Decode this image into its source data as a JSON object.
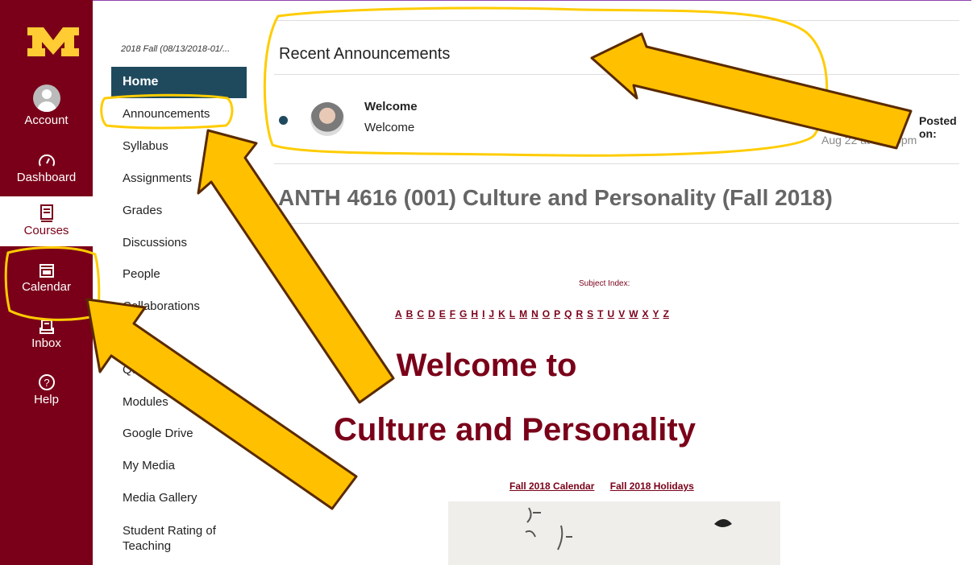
{
  "global_nav": {
    "logo_icon": "university-m-logo-icon",
    "items": [
      {
        "label": "Account",
        "icon": "account-icon"
      },
      {
        "label": "Dashboard",
        "icon": "dashboard-icon"
      },
      {
        "label": "Courses",
        "icon": "courses-icon"
      },
      {
        "label": "Calendar",
        "icon": "calendar-icon"
      },
      {
        "label": "Inbox",
        "icon": "inbox-icon"
      },
      {
        "label": "Help",
        "icon": "help-icon"
      }
    ]
  },
  "course_nav": {
    "term": "2018 Fall (08/13/2018-01/...",
    "items": [
      "Home",
      "Announcements",
      "Syllabus",
      "Assignments",
      "Grades",
      "Discussions",
      "People",
      "Collaborations",
      "",
      "Quizzes",
      "Modules",
      "Google Drive",
      "My Media",
      "Media Gallery",
      "Student Rating of Teaching"
    ]
  },
  "announcements": {
    "title": "Recent Announcements",
    "item": {
      "heading": "Welcome",
      "body": "Welcome",
      "posted_label": "Posted on:",
      "posted_date": "Aug 22 at 10:05pm"
    }
  },
  "course_title": "ANTH 4616 (001) Culture and Personality (Fall 2018)",
  "subject_index": {
    "label": "Subject Index:",
    "letters": [
      "A",
      "B",
      "C",
      "D",
      "E",
      "F",
      "G",
      "H",
      "I",
      "J",
      "K",
      "L",
      "M",
      "N",
      "O",
      "P",
      "Q",
      "R",
      "S",
      "T",
      "U",
      "V",
      "W",
      "X",
      "Y",
      "Z"
    ]
  },
  "welcome": {
    "line1": "Welcome to",
    "line2": "Culture and Personality"
  },
  "links": {
    "calendar": "Fall 2018 Calendar",
    "holidays": "Fall 2018 Holidays"
  },
  "colors": {
    "brand": "#7a0019",
    "gold": "#ffcc33",
    "nav_active": "#1f4a5e"
  }
}
